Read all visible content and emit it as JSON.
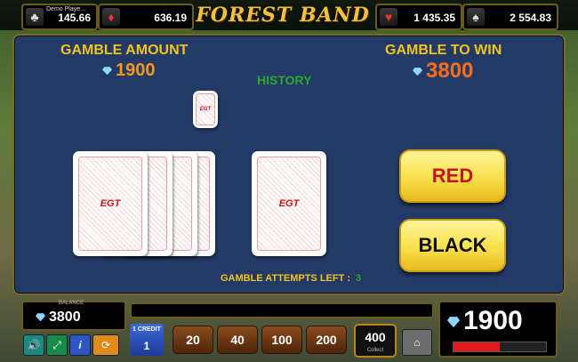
{
  "header": {
    "logo_text": "FOREST BAND",
    "jackpots": [
      {
        "suit": "clubs",
        "icon": "♣",
        "label": "Demo Playe...",
        "value": "145.66"
      },
      {
        "suit": "diamonds",
        "icon": "♦",
        "value": "636.19"
      },
      {
        "suit": "hearts",
        "icon": "♥",
        "value": "1 435.35"
      },
      {
        "suit": "spades",
        "icon": "♠",
        "value": "2 554.83"
      }
    ]
  },
  "gamble": {
    "amount_label": "GAMBLE AMOUNT",
    "amount_value": "1900",
    "to_win_label": "GAMBLE TO WIN",
    "to_win_value": "3800",
    "history_label": "HISTORY",
    "card_brand": "EGT",
    "red_label": "RED",
    "black_label": "BLACK",
    "attempts_label": "GAMBLE ATTEMPTS LEFT :",
    "attempts_value": "3"
  },
  "footer": {
    "balance_label": "BALANCE",
    "balance_value": "3800",
    "credit_label": "1 CREDIT",
    "credit_value": "1",
    "bets": [
      "20",
      "40",
      "100",
      "200"
    ],
    "collect_value": "400",
    "collect_label": "Collect",
    "win_value": "1900",
    "win_progress_pct": 50,
    "icons": [
      "speaker-icon",
      "fullscreen-icon",
      "info-icon",
      "autoplay-icon",
      "home-icon"
    ]
  },
  "colors": {
    "accent_gold": "#f0c31f",
    "panel_blue": "#243a66",
    "red": "#c4161c"
  }
}
